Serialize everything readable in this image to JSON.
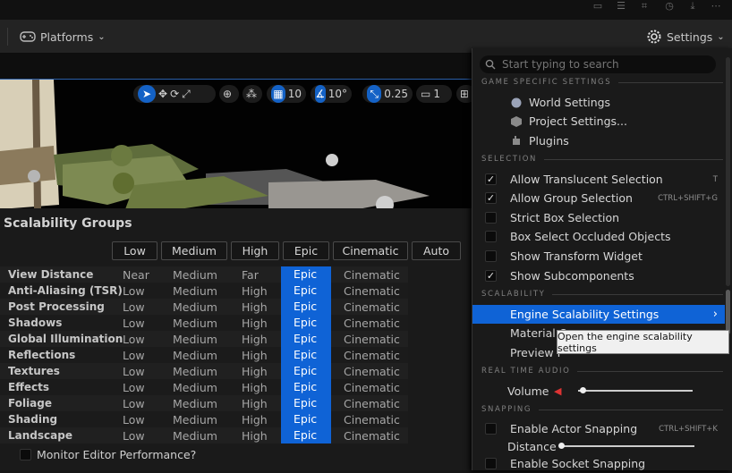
{
  "toolbar": {
    "platforms_label": "Platforms",
    "settings_label": "Settings"
  },
  "viewport_toolbar": {
    "grid_value": "10",
    "angle_value": "10°",
    "scale_value": "0.25",
    "camera_speed": "1"
  },
  "scalability": {
    "title": "Scalability Groups",
    "quality_buttons": [
      "Low",
      "Medium",
      "High",
      "Epic",
      "Cinematic",
      "Auto"
    ],
    "rows": [
      {
        "name": "View Distance",
        "c1": "Near",
        "c2": "Medium",
        "c3": "Far",
        "c4": "Epic",
        "c5": "Cinematic"
      },
      {
        "name": "Anti-Aliasing (TSR)",
        "c1": "Low",
        "c2": "Medium",
        "c3": "High",
        "c4": "Epic",
        "c5": "Cinematic"
      },
      {
        "name": "Post Processing",
        "c1": "Low",
        "c2": "Medium",
        "c3": "High",
        "c4": "Epic",
        "c5": "Cinematic"
      },
      {
        "name": "Shadows",
        "c1": "Low",
        "c2": "Medium",
        "c3": "High",
        "c4": "Epic",
        "c5": "Cinematic"
      },
      {
        "name": "Global Illumination",
        "c1": "Low",
        "c2": "Medium",
        "c3": "High",
        "c4": "Epic",
        "c5": "Cinematic"
      },
      {
        "name": "Reflections",
        "c1": "Low",
        "c2": "Medium",
        "c3": "High",
        "c4": "Epic",
        "c5": "Cinematic"
      },
      {
        "name": "Textures",
        "c1": "Low",
        "c2": "Medium",
        "c3": "High",
        "c4": "Epic",
        "c5": "Cinematic"
      },
      {
        "name": "Effects",
        "c1": "Low",
        "c2": "Medium",
        "c3": "High",
        "c4": "Epic",
        "c5": "Cinematic"
      },
      {
        "name": "Foliage",
        "c1": "Low",
        "c2": "Medium",
        "c3": "High",
        "c4": "Epic",
        "c5": "Cinematic"
      },
      {
        "name": "Shading",
        "c1": "Low",
        "c2": "Medium",
        "c3": "High",
        "c4": "Epic",
        "c5": "Cinematic"
      },
      {
        "name": "Landscape",
        "c1": "Low",
        "c2": "Medium",
        "c3": "High",
        "c4": "Epic",
        "c5": "Cinematic"
      }
    ],
    "monitor_label": "Monitor Editor Performance?",
    "selected_level": "Epic"
  },
  "menu": {
    "search_placeholder": "Start typing to search",
    "section_game": "GAME SPECIFIC SETTINGS",
    "world_settings": "World Settings",
    "project_settings": "Project Settings...",
    "plugins": "Plugins",
    "section_selection": "SELECTION",
    "allow_translucent": "Allow Translucent Selection",
    "allow_translucent_sc": "T",
    "allow_group": "Allow Group Selection",
    "allow_group_sc": "CTRL+SHIFT+G",
    "strict_box": "Strict Box Selection",
    "box_occluded": "Box Select Occluded Objects",
    "show_transform": "Show Transform Widget",
    "show_subcomponents": "Show Subcomponents",
    "section_scalability": "SCALABILITY",
    "engine_scalability": "Engine Scalability Settings",
    "material_q": "Material Q",
    "preview_f": "Preview F",
    "section_audio": "REAL TIME AUDIO",
    "volume": "Volume",
    "volume_level": 0.03,
    "section_snapping": "SNAPPING",
    "enable_actor_snapping": "Enable Actor Snapping",
    "enable_actor_snapping_sc": "CTRL+SHIFT+K",
    "distance": "Distance",
    "distance_level": 0.0,
    "enable_socket_snapping": "Enable Socket Snapping"
  },
  "tooltip": "Open the engine scalability settings",
  "colors": {
    "accent": "#0f63d6",
    "background": "#1a1a1a"
  }
}
